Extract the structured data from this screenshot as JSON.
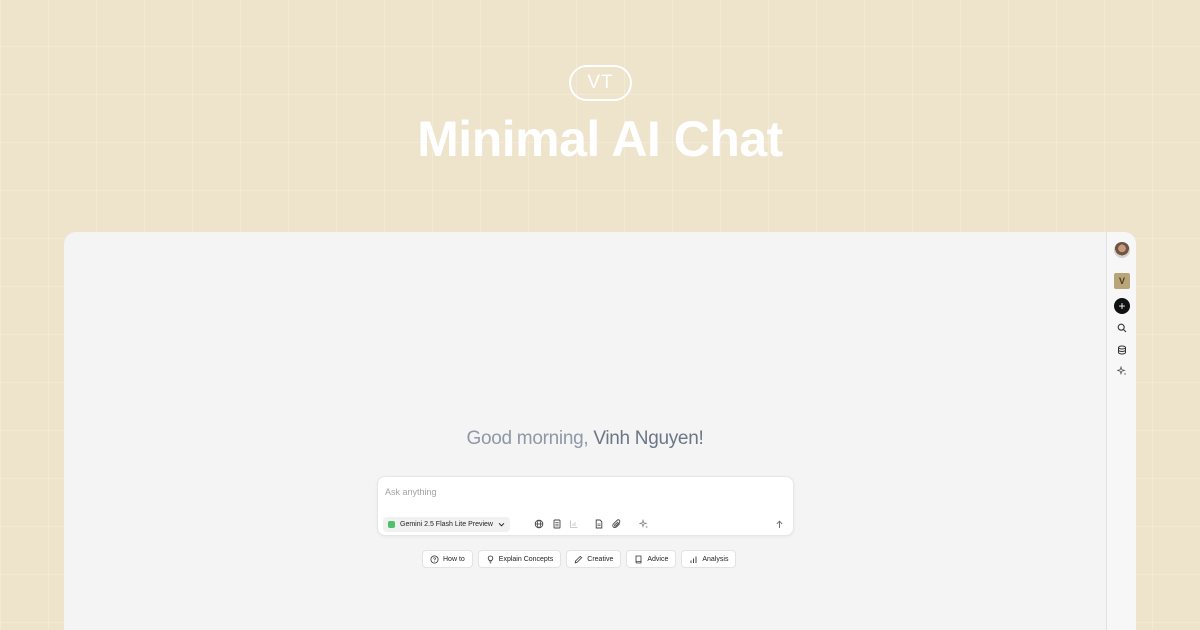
{
  "hero": {
    "logo": "VT",
    "title": "Minimal AI Chat"
  },
  "rail": {
    "items": [
      {
        "name": "user-avatar",
        "icon": "avatar"
      },
      {
        "name": "app-logo",
        "icon": "logo",
        "label": "V"
      },
      {
        "name": "new-chat",
        "icon": "plus-icon"
      },
      {
        "name": "search",
        "icon": "search-icon"
      },
      {
        "name": "library",
        "icon": "database-icon"
      },
      {
        "name": "sparkles",
        "icon": "sparkle-icon"
      }
    ]
  },
  "greeting": {
    "salutation": "Good morning,",
    "name": "Vinh Nguyen!"
  },
  "composer": {
    "placeholder": "Ask anything",
    "model": "Gemini 2.5 Flash Lite Preview",
    "tools": [
      "globe-icon",
      "document-icon",
      "chart-icon",
      "file-icon",
      "paperclip-icon",
      "sparkle-icon"
    ],
    "send_icon": "arrow-up-icon"
  },
  "suggestions": [
    {
      "label": "How to",
      "icon": "help-circle-icon"
    },
    {
      "label": "Explain Concepts",
      "icon": "lightbulb-icon"
    },
    {
      "label": "Creative",
      "icon": "pencil-icon"
    },
    {
      "label": "Advice",
      "icon": "book-icon"
    },
    {
      "label": "Analysis",
      "icon": "bar-chart-icon"
    }
  ],
  "colors": {
    "background": "#eee3cb",
    "app_surface": "#f4f4f4",
    "greeting_muted": "#8e98a6",
    "greeting_name": "#6b7686",
    "model_accent": "#4cc26a"
  }
}
